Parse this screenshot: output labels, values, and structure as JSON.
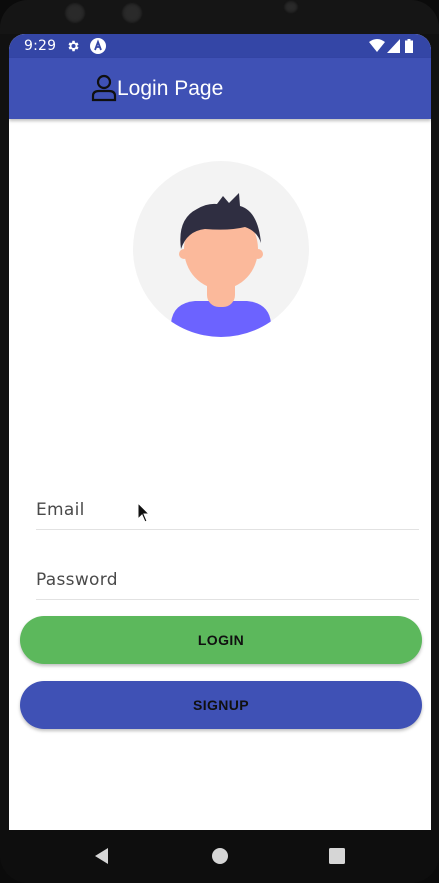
{
  "status_bar": {
    "time": "9:29",
    "icons": [
      "settings-gear-icon",
      "a-notification-icon",
      "wifi-icon",
      "signal-icon",
      "battery-icon"
    ]
  },
  "app_bar": {
    "icon": "person-outline-icon",
    "title": "Login Page"
  },
  "avatar": {
    "icon": "user-avatar-illustration"
  },
  "form": {
    "email_label": "Email",
    "password_label": "Password"
  },
  "buttons": {
    "login_label": "LOGIN",
    "signup_label": "SIGNUP"
  },
  "nav_bar": {
    "icons": [
      "back-triangle-icon",
      "home-circle-icon",
      "recents-square-icon"
    ]
  },
  "colors": {
    "primary": "#3f51b5",
    "primary_dark": "#3446a6",
    "login_button": "#5cb85c",
    "signup_button": "#3f51b5",
    "avatar_bg": "#f3f3f3",
    "skin": "#fbb99b",
    "hair": "#2f2e41",
    "shirt": "#6c63ff"
  }
}
